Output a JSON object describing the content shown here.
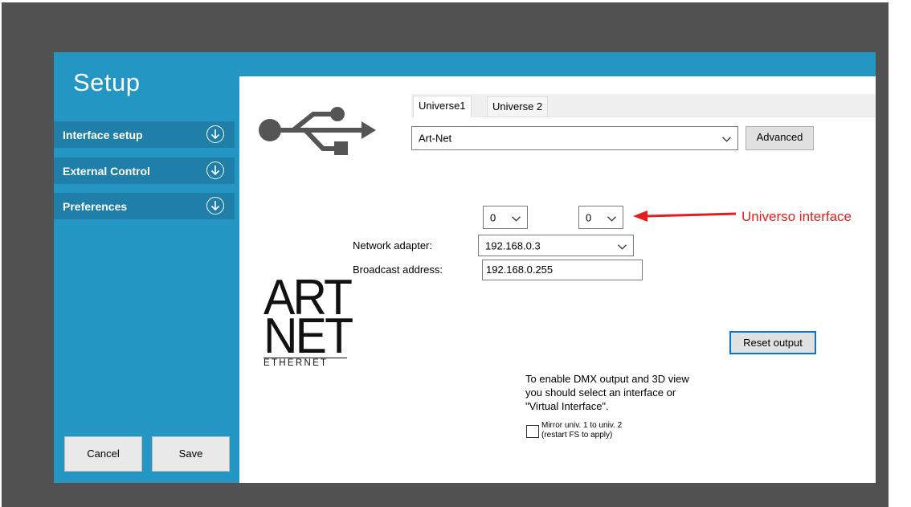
{
  "sidebar": {
    "title": "Setup",
    "items": [
      {
        "label": "Interface setup"
      },
      {
        "label": "External Control"
      },
      {
        "label": "Preferences"
      }
    ],
    "cancel_label": "Cancel",
    "save_label": "Save"
  },
  "tabs": [
    {
      "label": "Universe1",
      "active": true
    },
    {
      "label": "Universe 2",
      "active": false
    }
  ],
  "interface": {
    "protocol_value": "Art-Net",
    "advanced_label": "Advanced",
    "universe_a_value": "0",
    "universe_b_value": "0",
    "network_adapter_label": "Network adapter:",
    "network_adapter_value": "192.168.0.3",
    "broadcast_label": "Broadcast address:",
    "broadcast_value": "192.168.0.255",
    "reset_label": "Reset output"
  },
  "annotation": {
    "text": "Universo interface",
    "color": "#e31e1e"
  },
  "logo": {
    "line1": "ART",
    "line2": "NET",
    "line3": "ETHERNET"
  },
  "info": {
    "line1": "To enable DMX output and 3D view",
    "line2": "you should select an interface or",
    "line3": "\"Virtual Interface\".",
    "mirror_line1": "Mirror univ. 1 to univ. 2",
    "mirror_line2": "(restart FS to apply)"
  },
  "colors": {
    "accent": "#2496c3",
    "sidebar_item": "#1f7fa8",
    "backdrop": "#515151"
  }
}
